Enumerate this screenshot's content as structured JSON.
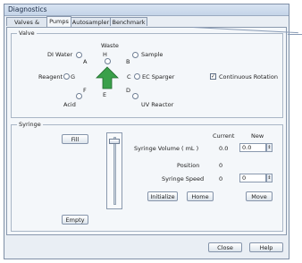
{
  "window": {
    "title": "Diagnostics"
  },
  "tabs": [
    {
      "label": "Valves & Flows",
      "active": false
    },
    {
      "label": "Pumps",
      "active": true
    },
    {
      "label": "Autosampler",
      "active": false
    },
    {
      "label": "Benchmark",
      "active": false
    }
  ],
  "valve": {
    "group_label": "Valve",
    "ports": {
      "top_label": "Waste",
      "top_letter": "H",
      "right_upper_label": "Sample",
      "left_upper_label": "DI Water",
      "left_label": "Reagent",
      "left_letter": "G",
      "right_letter": "C",
      "right_label": "EC Sparger",
      "bottom_left_label": "Acid",
      "bottom_right_label": "UV Reactor",
      "bottom_letter": "E",
      "lower_left_letter": "F",
      "lower_right_letter": "D",
      "upper_right_letter": "B",
      "upper_left_letter": "A"
    },
    "continuous_rotation_label": "Continuous Rotation",
    "continuous_rotation_checked": true
  },
  "syringe": {
    "group_label": "Syringe",
    "fill_button": "Fill",
    "empty_button": "Empty",
    "col_current": "Current",
    "col_new": "New",
    "volume_label": "Syringe Volume ( mL )",
    "volume_current": "0.0",
    "volume_new": "0.0",
    "position_label": "Position",
    "position_value": "0",
    "speed_label": "Syringe Speed",
    "speed_current": "0",
    "speed_new": "0",
    "initialize_button": "Initialize",
    "home_button": "Home",
    "move_button": "Move",
    "level": 0.0
  },
  "footer": {
    "close_button": "Close",
    "help_button": "Help"
  },
  "colors": {
    "arrow": "#3aa04a",
    "title_bg": "#c4d4e8"
  }
}
